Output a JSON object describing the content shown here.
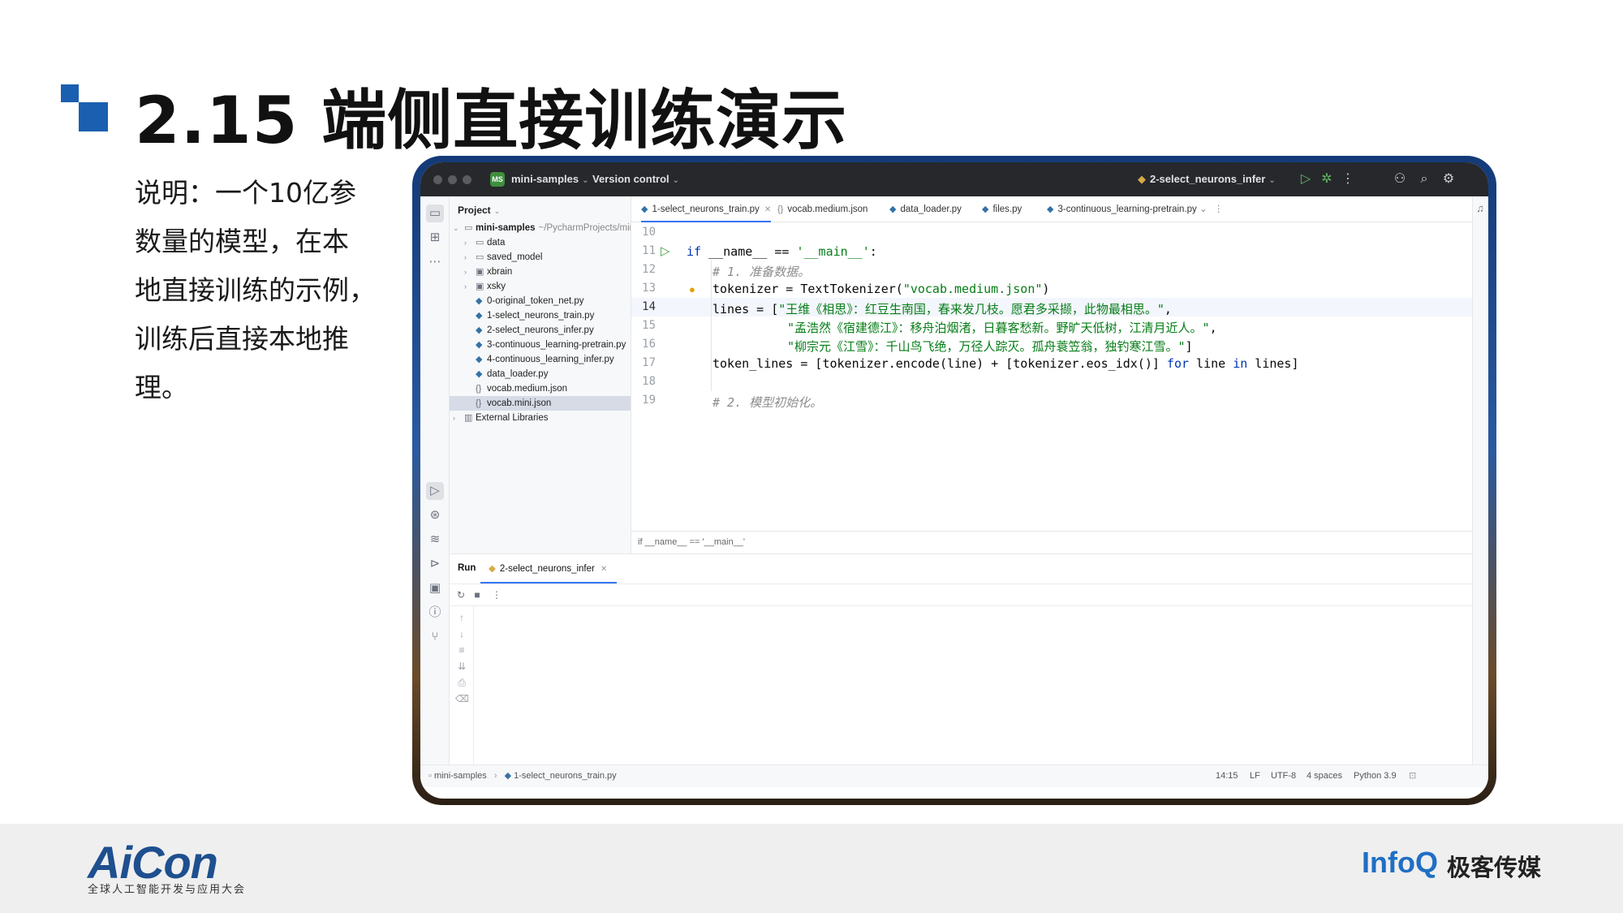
{
  "slide": {
    "title": "2.15 端侧直接训练演示",
    "description_lines": [
      "说明：一个10亿参",
      "数量的模型，在本",
      "地直接训练的示例，",
      "训练后直接本地推",
      "理。"
    ]
  },
  "footer": {
    "aicon_logo": "AiCon",
    "aicon_subtitle": "全球人工智能开发与应用大会",
    "infoq_logo": "InfoQ",
    "infoq_subtitle": "极客传媒"
  },
  "titlebar": {
    "project_badge": "MS",
    "project_name": "mini-samples",
    "vcs": "Version control",
    "run_config": "2-select_neurons_infer"
  },
  "project_panel": {
    "header": "Project",
    "root_name": "mini-samples",
    "root_path": "~/PycharmProjects/mini-s",
    "items": [
      {
        "label": "data",
        "kind": "folder"
      },
      {
        "label": "saved_model",
        "kind": "folder"
      },
      {
        "label": "xbrain",
        "kind": "package"
      },
      {
        "label": "xsky",
        "kind": "package"
      },
      {
        "label": "0-original_token_net.py",
        "kind": "py"
      },
      {
        "label": "1-select_neurons_train.py",
        "kind": "py"
      },
      {
        "label": "2-select_neurons_infer.py",
        "kind": "py"
      },
      {
        "label": "3-continuous_learning-pretrain.py",
        "kind": "py"
      },
      {
        "label": "4-continuous_learning_infer.py",
        "kind": "py"
      },
      {
        "label": "data_loader.py",
        "kind": "py"
      },
      {
        "label": "vocab.medium.json",
        "kind": "json"
      },
      {
        "label": "vocab.mini.json",
        "kind": "json"
      }
    ],
    "external": "External Libraries"
  },
  "editor": {
    "tabs": [
      {
        "label": "1-select_neurons_train.py"
      },
      {
        "label": "vocab.medium.json"
      },
      {
        "label": "data_loader.py"
      },
      {
        "label": "files.py"
      },
      {
        "label": "3-continuous_learning-pretrain.py"
      }
    ],
    "line_numbers": [
      "10",
      "11",
      "12",
      "13",
      "14",
      "15",
      "16",
      "17",
      "18",
      "19"
    ],
    "code": {
      "l11_kw": "if",
      "l11_name": " __name__ == ",
      "l11_str": "'__main__'",
      "l11_end": ":",
      "l12": "# 1. 准备数据。",
      "l13_a": "tokenizer = TextTokenizer(",
      "l13_str": "\"vocab.medium.json\"",
      "l13_b": ")",
      "l14_a": "lines = [",
      "l14_str": "\"王维《相思》：红豆生南国，春来发几枝。愿君多采撷，此物最相思。\"",
      "l14_b": ",",
      "l15_str": "\"孟浩然《宿建德江》：移舟泊烟渚，日暮客愁新。野旷天低树，江清月近人。\"",
      "l15_b": ",",
      "l16_str": "\"柳宗元《江雪》：千山鸟飞绝，万径人踪灭。孤舟蓑笠翁，独钓寒江雪。\"",
      "l16_b": "]",
      "l17_a": "token_lines = [tokenizer.encode(line) + [tokenizer.eos_idx()] ",
      "l17_kw1": "for",
      "l17_b": " line ",
      "l17_kw2": "in",
      "l17_c": " lines]",
      "l19": "# 2. 模型初始化。"
    },
    "breadcrumb": "if __name__ == '__main__'"
  },
  "run_panel": {
    "title": "Run",
    "tab": "2-select_neurons_infer"
  },
  "statusbar": {
    "project": "mini-samples",
    "file": "1-select_neurons_train.py",
    "position": "14:15",
    "line_sep": "LF",
    "encoding": "UTF-8",
    "indent": "4 spaces",
    "interpreter": "Python 3.9"
  }
}
